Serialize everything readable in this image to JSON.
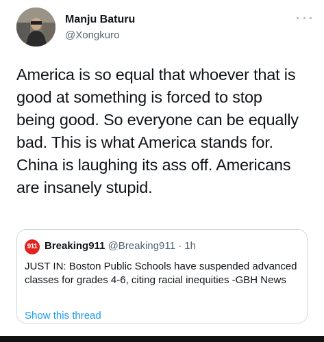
{
  "tweet": {
    "author_name": "Manju Baturu",
    "author_handle": "@Xongkuro",
    "more_icon": "more-horizontal-icon",
    "text": "America is so equal that whoever that is\ngood at something is forced to stop\nbeing good. So everyone can be equally\nbad. This is what America stands for.\nChina is laughing its ass off. Americans\nare insanely stupid."
  },
  "quote": {
    "avatar_text": "911",
    "avatar_color": "#e0231f",
    "author_name": "Breaking911",
    "author_handle": "@Breaking911",
    "separator": " · ",
    "time": "1h",
    "text": "JUST IN: Boston Public Schools have suspended advanced classes for grades 4-6, citing racial inequities -GBH News",
    "link": "Show this thread"
  },
  "colors": {
    "link": "#1d9bf0",
    "secondary_text": "#536471",
    "border": "#cfd9de"
  }
}
